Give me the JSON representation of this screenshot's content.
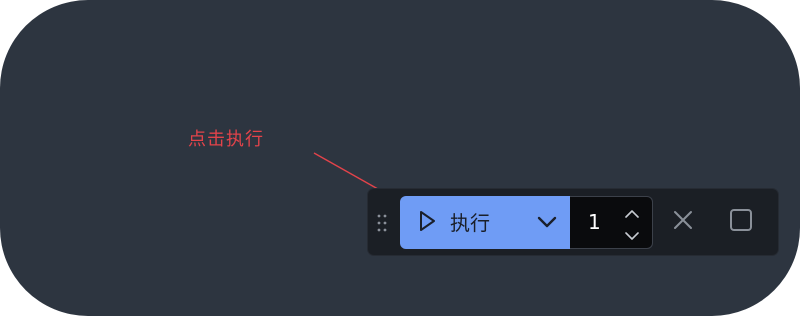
{
  "annotation": {
    "text": "点击执行",
    "color": "#e2434a"
  },
  "toolbar": {
    "drag_handle_icon": "drag-handle-icon",
    "run_icon": "play-icon",
    "run_label": "执行",
    "dropdown_icon": "chevron-down-icon",
    "accent_color": "#6f9cf5",
    "count": {
      "value": "1",
      "up_icon": "chevron-up-icon",
      "down_icon": "chevron-down-icon"
    },
    "close_icon": "close-icon",
    "square_icon": "square-icon"
  }
}
